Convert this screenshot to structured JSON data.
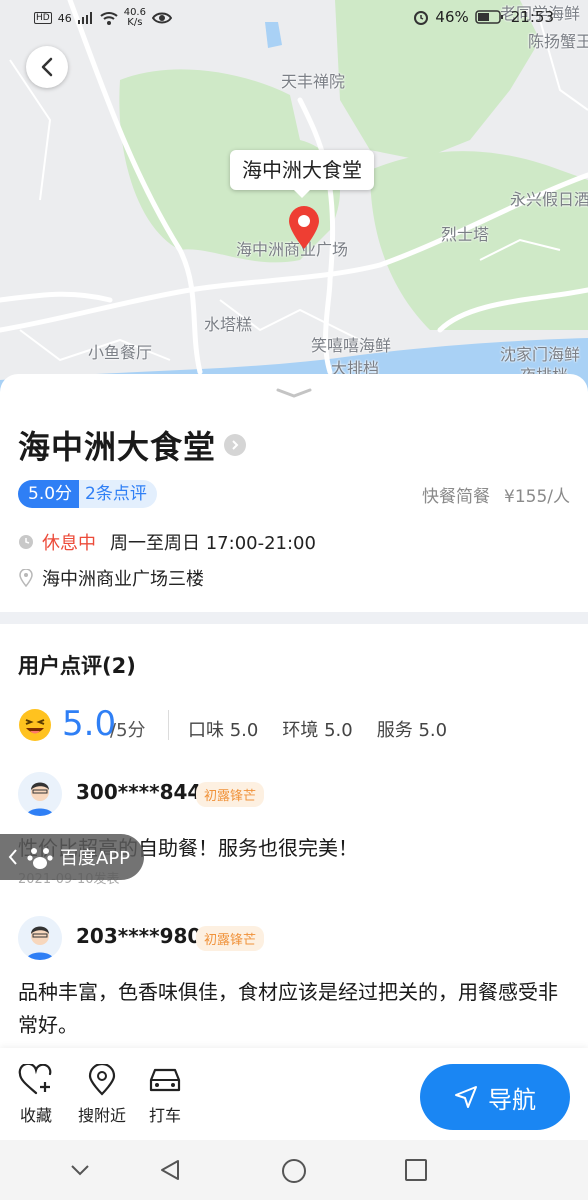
{
  "status_bar": {
    "left_hd": "HD",
    "left_net": "46",
    "speed_value": "40.6",
    "speed_unit": "K/s",
    "battery": "46%",
    "time": "21:53"
  },
  "map": {
    "callout": "海中洲大食堂",
    "labels": {
      "l1": "天丰禅院",
      "l2": "海中洲商业广场",
      "l3": "烈士塔",
      "l4": "永兴假日酒",
      "l5": "水塔糕",
      "l6": "小鱼餐厅",
      "l7": "笑嘻嘻海鲜",
      "l8": "大排档",
      "l9": "沈家门海鲜",
      "l10": "夜排档",
      "l11": "老同学海鲜",
      "l12": "陈扬蟹王"
    },
    "colors": {
      "water": "#a9d1f5",
      "green": "#cfe9c7",
      "road": "#ffffff"
    }
  },
  "place": {
    "name": "海中洲大食堂",
    "score": "5.0分",
    "review_count": "2条点评",
    "category": "快餐简餐",
    "price": "¥155/人",
    "status": "休息中",
    "hours": "周一至周日 17:00-21:00",
    "address": "海中洲商业广场三楼"
  },
  "reviews_section": {
    "title": "用户点评",
    "count": "(2)",
    "big_score": "5.0",
    "out_of": "/5分",
    "taste": "口味 5.0",
    "environment": "环境 5.0",
    "service": "服务 5.0",
    "items": [
      {
        "user": "300****844",
        "badge": "初露锋芒",
        "text": "性价比超高的自助餐！服务也很完美！",
        "date": "2021-09-10发表"
      },
      {
        "user": "203****980",
        "badge": "初露锋芒",
        "text": "品种丰富，色香味俱佳，食材应该是经过把关的，用餐感受非常好。",
        "date": ""
      }
    ]
  },
  "baidu_pill": {
    "label": "百度APP"
  },
  "actions": {
    "favorite": "收藏",
    "nearby": "搜附近",
    "taxi": "打车",
    "navigate": "导航"
  },
  "colors": {
    "accent": "#2f7ff5",
    "closed": "#ec4b3a",
    "badge": "#f0923a"
  }
}
